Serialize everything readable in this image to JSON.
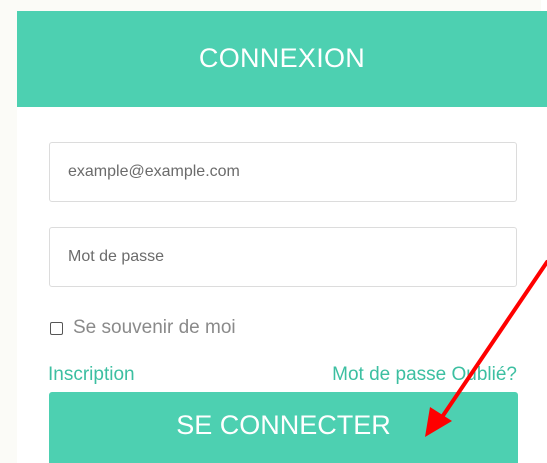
{
  "header": {
    "title": "CONNEXION"
  },
  "form": {
    "email_placeholder": "example@example.com",
    "password_placeholder": "Mot de passe",
    "remember_label": "Se souvenir de moi",
    "signup_link": "Inscription",
    "forgot_link": "Mot de passe Oublié?",
    "submit_label": "SE CONNECTER"
  },
  "colors": {
    "accent": "#4dd0b1",
    "link": "#3cbfa1",
    "annotation_arrow": "#ff0000"
  },
  "annotation": {
    "arrow_target": "submit-button"
  }
}
